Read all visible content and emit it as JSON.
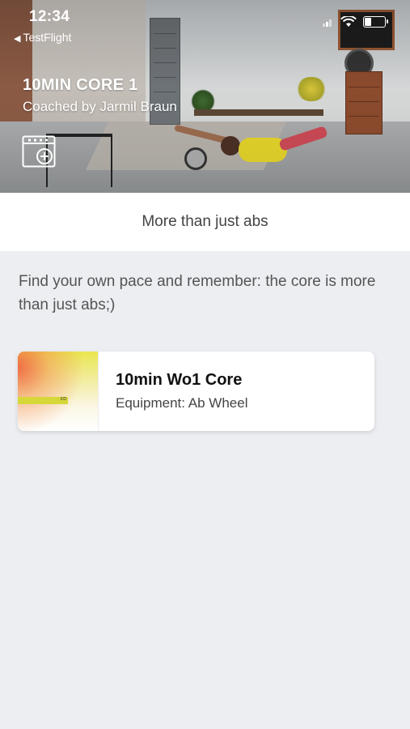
{
  "status_bar": {
    "time": "12:34",
    "back_app": "TestFlight"
  },
  "hero": {
    "title": "10MIN CORE 1",
    "coach": "Coached by Jarmil Braun",
    "add_to_calendar_icon": "calendar-add-icon"
  },
  "subheader": {
    "text": "More than just abs"
  },
  "description": {
    "text": "Find your own pace and remember: the core is more than just abs;)"
  },
  "workouts": [
    {
      "title": "10min Wo1 Core",
      "equipment": "Equipment: Ab Wheel",
      "thumb_label": "co"
    }
  ],
  "colors": {
    "background": "#eceef1",
    "card": "#ffffff",
    "thumb_yellow": "#e9e650",
    "thumb_orange": "#f05a3c"
  }
}
